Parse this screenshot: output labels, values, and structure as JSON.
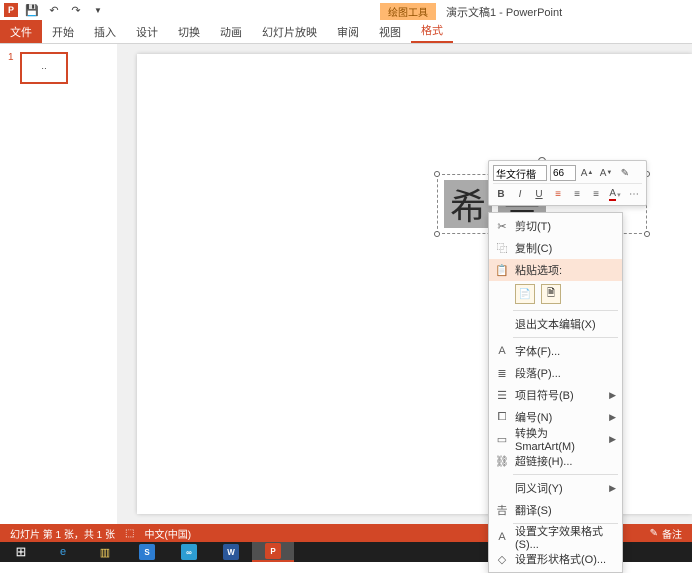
{
  "app": {
    "contextual_tab": "绘图工具",
    "title": "演示文稿1 - PowerPoint"
  },
  "ribbon": {
    "tabs": [
      "文件",
      "开始",
      "插入",
      "设计",
      "切换",
      "动画",
      "幻灯片放映",
      "审阅",
      "视图",
      "格式"
    ]
  },
  "thumbnail": {
    "number": "1"
  },
  "textbox": {
    "char1": "希",
    "char2": "吾"
  },
  "mini_toolbar": {
    "font": "华文行楷",
    "size": "66",
    "row2": {
      "bold": "B",
      "italic": "I",
      "underline": "U"
    }
  },
  "context_menu": {
    "items": [
      {
        "icon": "✂",
        "label": "剪切(T)",
        "key": "cut"
      },
      {
        "icon": "⿻",
        "label": "复制(C)",
        "key": "copy"
      },
      {
        "icon": "📋",
        "label": "粘贴选项:",
        "key": "paste-options",
        "hover": true
      },
      {
        "sep": true
      },
      {
        "icon": "",
        "label": "退出文本编辑(X)",
        "key": "exit-text"
      },
      {
        "sep": true
      },
      {
        "icon": "A",
        "label": "字体(F)...",
        "key": "font"
      },
      {
        "icon": "≣",
        "label": "段落(P)...",
        "key": "para"
      },
      {
        "icon": "☰",
        "label": "项目符号(B)",
        "key": "bullets",
        "sub": true
      },
      {
        "icon": "⧠",
        "label": "编号(N)",
        "key": "numbering",
        "sub": true
      },
      {
        "icon": "▭",
        "label": "转换为 SmartArt(M)",
        "key": "smartart",
        "sub": true
      },
      {
        "icon": "⛓",
        "label": "超链接(H)...",
        "key": "hyperlink"
      },
      {
        "sep": true
      },
      {
        "icon": "",
        "label": "同义词(Y)",
        "key": "syn",
        "sub": true
      },
      {
        "icon": "𠮷",
        "label": "翻译(S)",
        "key": "translate"
      },
      {
        "sep": true
      },
      {
        "icon": "A",
        "label": "设置文字效果格式(S)...",
        "key": "textfx"
      },
      {
        "icon": "◇",
        "label": "设置形状格式(O)...",
        "key": "shapefmt"
      }
    ]
  },
  "status": {
    "left": "幻灯片 第 1 张，共 1 张",
    "lang_icon": "⬚",
    "lang": "中文(中国)",
    "notes": "备注"
  },
  "taskbar": {
    "word": "W",
    "ppt": "P"
  }
}
